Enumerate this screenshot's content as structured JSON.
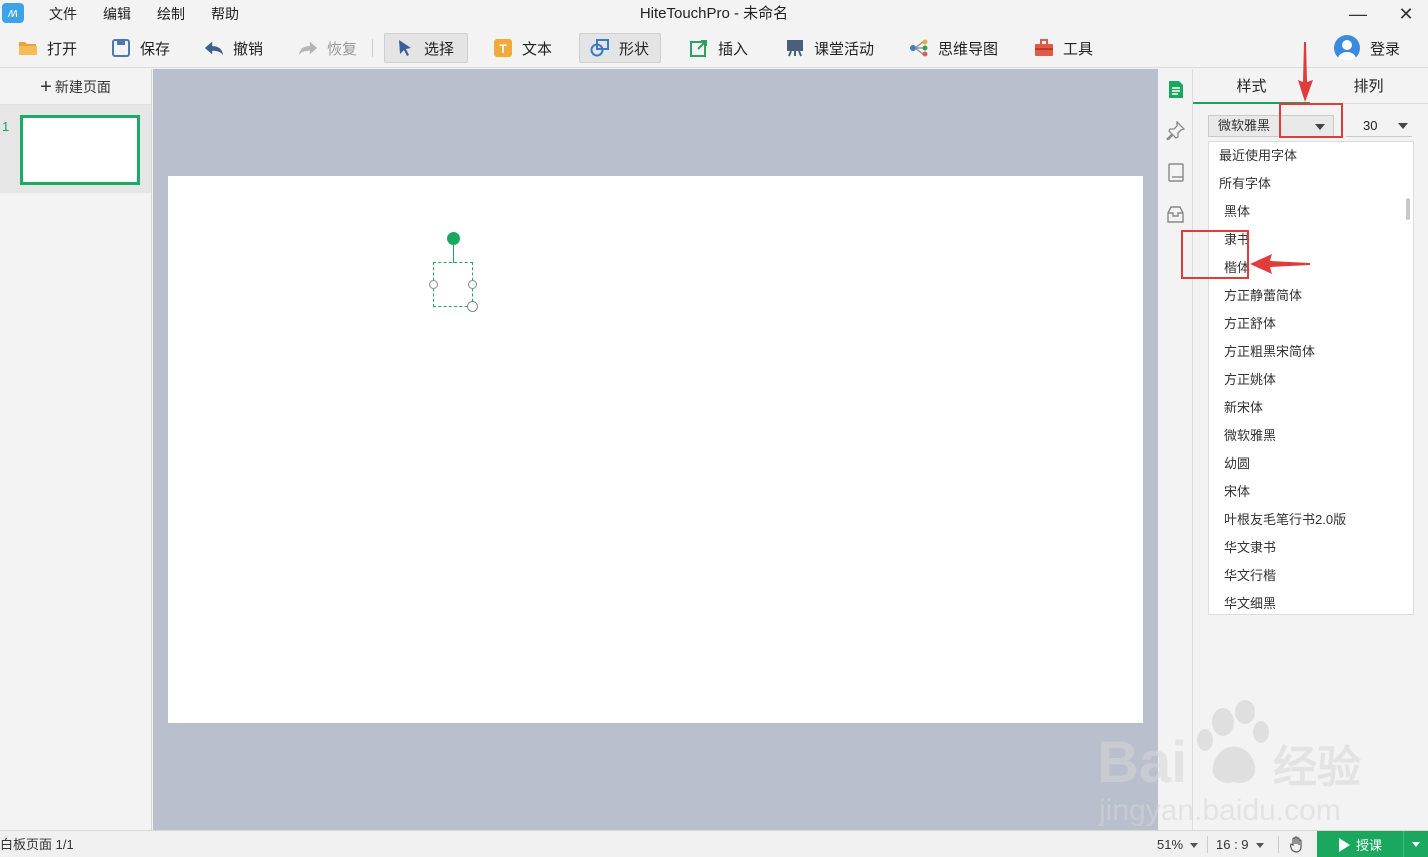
{
  "window": {
    "title": "HiteTouchPro - 未命名",
    "minimize": "—",
    "close": "✕"
  },
  "menu": [
    "文件",
    "编辑",
    "绘制",
    "帮助"
  ],
  "toolbar": {
    "open": "打开",
    "save": "保存",
    "undo": "撤销",
    "redo": "恢复",
    "select": "选择",
    "text": "文本",
    "shape": "形状",
    "insert": "插入",
    "classroom": "课堂活动",
    "mindmap": "思维导图",
    "tools": "工具",
    "login": "登录"
  },
  "left_panel": {
    "new_page": "新建页面",
    "pages": [
      {
        "number": "1"
      }
    ]
  },
  "right_panel": {
    "tabs": [
      "样式",
      "排列"
    ],
    "active_tab": "样式",
    "font_value": "微软雅黑",
    "size_value": "30",
    "font_groups": [
      "最近使用字体",
      "所有字体"
    ],
    "fonts": [
      "黑体",
      "隶书",
      "楷体",
      "方正静蕾简体",
      "方正舒体",
      "方正粗黑宋简体",
      "方正姚体",
      "新宋体",
      "微软雅黑",
      "幼圆",
      "宋体",
      "叶根友毛笔行书2.0版",
      "华文隶书",
      "华文行楷",
      "华文细黑"
    ]
  },
  "status": {
    "page_info": "白板页面 1/1",
    "zoom": "51%",
    "ratio": "16 : 9",
    "start": "授课"
  },
  "colors": {
    "accent": "#19a85e",
    "canvas_bg": "#b9bfcc",
    "annotation": "#e03c3c",
    "avatar": "#3a8be0"
  },
  "watermark": {
    "text_main": "Bai",
    "text_cn": "经验",
    "text_url": "jingyan.baidu.com"
  }
}
